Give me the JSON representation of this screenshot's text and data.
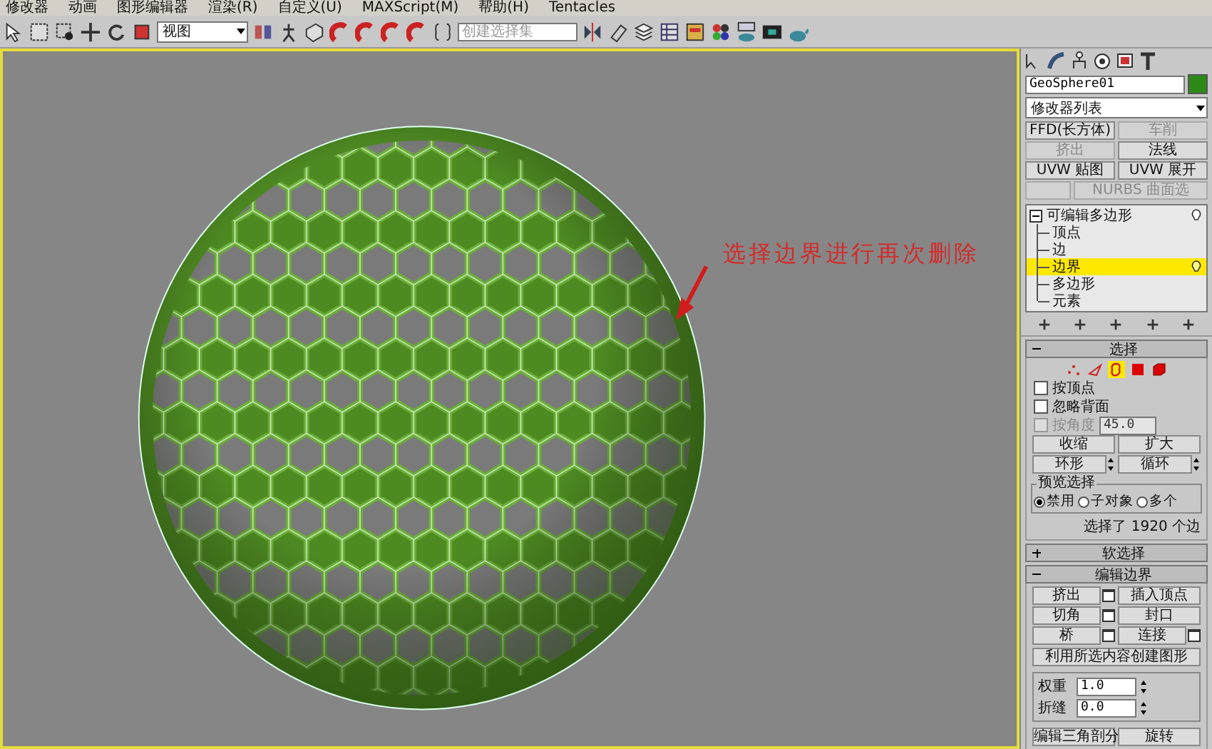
{
  "menu": [
    "修改器",
    "动画",
    "图形编辑器",
    "渲染(R)",
    "自定义(U)",
    "MAXScript(M)",
    "帮助(H)",
    "Tentacles"
  ],
  "toolbar": {
    "view_dropdown": "视图",
    "selection_set": {
      "placeholder": "创建选择集"
    }
  },
  "viewport": {
    "annotation": "选择边界进行再次删除"
  },
  "command_panel": {
    "object_name": "GeoSphere01",
    "modifier_list": "修改器列表",
    "modifier_buttons": [
      {
        "label": "FFD(长方体)",
        "disabled": false
      },
      {
        "label": "车削",
        "disabled": true
      },
      {
        "label": "挤出",
        "disabled": true
      },
      {
        "label": "法线",
        "disabled": false
      },
      {
        "label": "UVW 贴图",
        "disabled": false
      },
      {
        "label": "UVW 展开",
        "disabled": false
      },
      {
        "disabled": true
      },
      {
        "label": "NURBS 曲面选",
        "disabled": true
      }
    ],
    "stack": {
      "label": "可编辑多边形",
      "expanded": true,
      "children": [
        {
          "label": "顶点",
          "selected": false
        },
        {
          "label": "边",
          "selected": false
        },
        {
          "label": "边界",
          "selected": true
        },
        {
          "label": "多边形",
          "selected": false
        },
        {
          "label": "元素",
          "selected": false
        }
      ]
    },
    "selection_rollout": {
      "title": "选择",
      "expanded": true,
      "subobject_modes": [
        {
          "kind": "vertex",
          "selected": false
        },
        {
          "kind": "edge",
          "selected": false
        },
        {
          "kind": "border",
          "selected": true
        },
        {
          "kind": "polygon",
          "selected": false
        },
        {
          "kind": "element",
          "selected": false
        }
      ],
      "checkboxes": [
        {
          "label": "按顶点",
          "checked": false,
          "disabled": false
        },
        {
          "label": "忽略背面",
          "checked": false,
          "disabled": false
        },
        {
          "label": "按角度",
          "checked": false,
          "disabled": true,
          "value": "45.0"
        }
      ],
      "buttons": [
        {
          "label": "收缩",
          "kind": "plain"
        },
        {
          "label": "扩大",
          "kind": "plain"
        },
        {
          "label": "环形",
          "kind": "spinner"
        },
        {
          "label": "循环",
          "kind": "spinner"
        }
      ],
      "preview_selection": {
        "title": "预览选择",
        "options": [
          {
            "label": "禁用",
            "selected": true
          },
          {
            "label": "子对象",
            "selected": false
          },
          {
            "label": "多个",
            "selected": false
          }
        ]
      },
      "status": "选择了 1920 个边"
    },
    "soft_selection_rollout": {
      "title": "软选择",
      "expanded": false
    },
    "edit_borders_rollout": {
      "title": "编辑边界",
      "expanded": true,
      "buttons": [
        {
          "label": "挤出",
          "settings": true
        },
        {
          "label": "插入顶点",
          "settings": false
        },
        {
          "label": "切角",
          "settings": true
        },
        {
          "label": "封口",
          "settings": false
        },
        {
          "label": "桥",
          "settings": true
        },
        {
          "label": "连接",
          "settings": true
        }
      ],
      "create_shape_button": "利用所选内容创建图形",
      "spinners": [
        {
          "label": "权重",
          "value": "1.0"
        },
        {
          "label": "折缝",
          "value": "0.0"
        }
      ],
      "bottom_buttons": [
        "编辑三角剖分",
        "旋转"
      ]
    }
  }
}
